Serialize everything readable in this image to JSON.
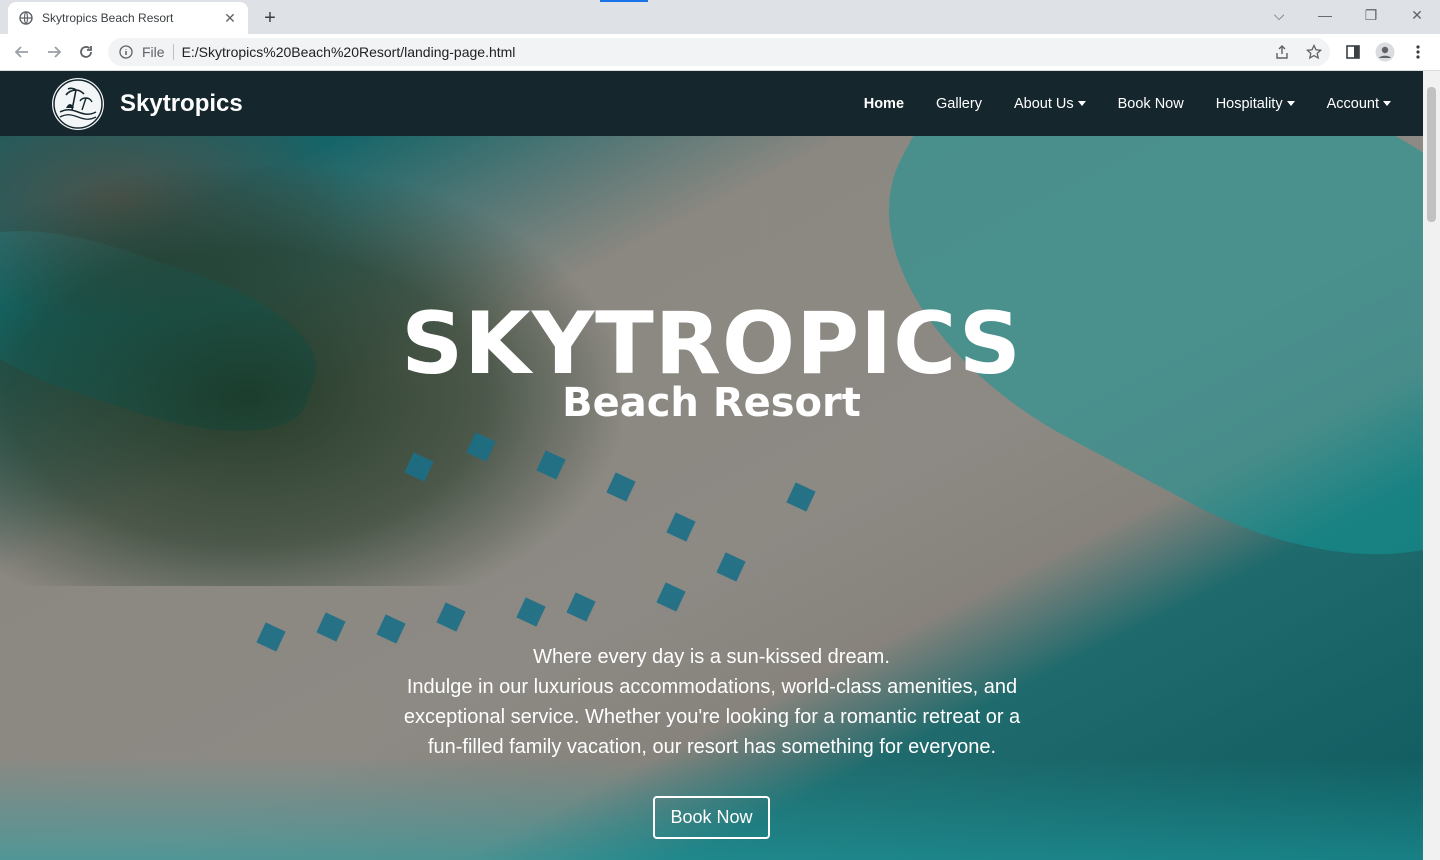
{
  "browser": {
    "tab_title": "Skytropics Beach Resort",
    "scheme_label": "File",
    "url": "E:/Skytropics%20Beach%20Resort/landing-page.html"
  },
  "site": {
    "brand": "Skytropics",
    "nav": [
      {
        "label": "Home",
        "active": true
      },
      {
        "label": "Gallery"
      },
      {
        "label": "About Us",
        "dropdown": true
      },
      {
        "label": "Book Now"
      },
      {
        "label": "Hospitality",
        "dropdown": true
      },
      {
        "label": "Account",
        "dropdown": true
      }
    ]
  },
  "hero": {
    "title": "SKYTROPICS",
    "subtitle": "Beach Resort",
    "tagline": "Where every day is a sun-kissed dream.",
    "description": "Indulge in our luxurious accommodations, world-class amenities, and exceptional service. Whether you're looking for a romantic retreat or a fun-filled family vacation, our resort has something for everyone.",
    "cta": "Book Now"
  },
  "colors": {
    "navbar": "#15262d",
    "tabbar": "#dee1e6",
    "accent": "#1a73e8"
  }
}
